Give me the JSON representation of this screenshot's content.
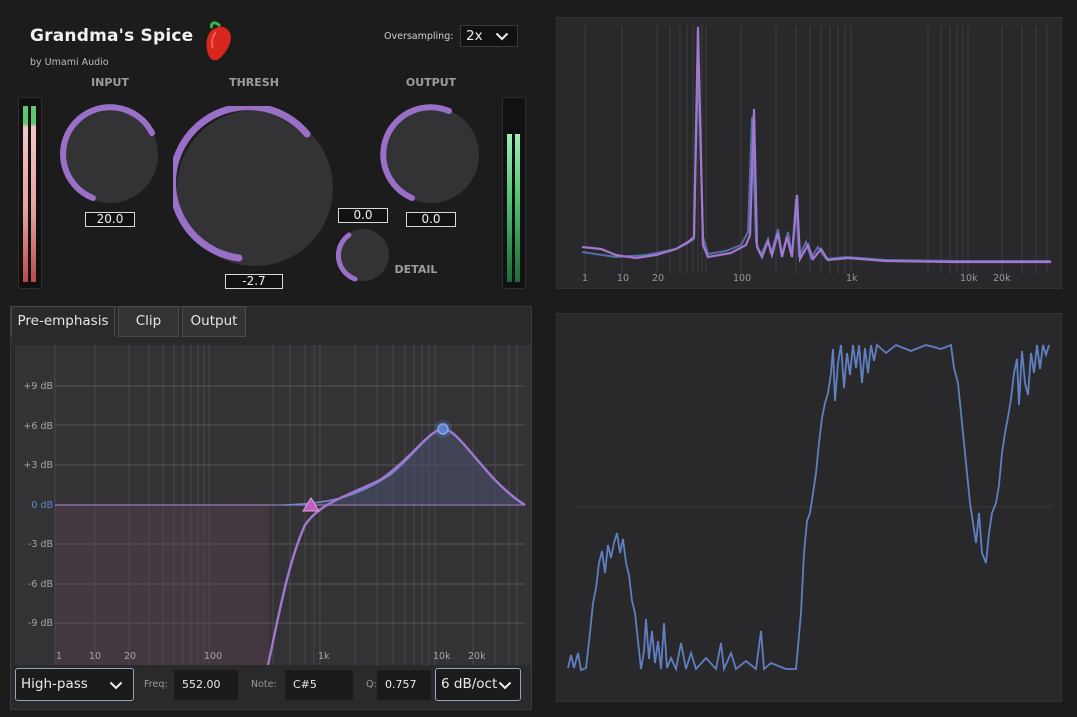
{
  "plugin": {
    "title": "Grandma's Spice",
    "subtitle": "by Umami Audio",
    "logo_icon": "chili-pepper-icon"
  },
  "oversampling": {
    "label": "Oversampling:",
    "value": "2x"
  },
  "knobs": {
    "input": {
      "label": "INPUT",
      "value": "20.0"
    },
    "thresh": {
      "label": "THRESH",
      "value": "-2.7"
    },
    "output": {
      "label": "OUTPUT",
      "value": "0.0"
    },
    "detail": {
      "label": "DETAIL",
      "value": "0.0"
    }
  },
  "tabs": [
    {
      "label": "Pre-emphasis",
      "active": true
    },
    {
      "label": "Clip",
      "active": false
    },
    {
      "label": "Output",
      "active": false
    }
  ],
  "eq_graph": {
    "db_labels": [
      "+9 dB",
      "+6 dB",
      "+3 dB",
      "0 dB",
      "-3 dB",
      "-6 dB",
      "-9 dB"
    ],
    "freq_labels": [
      "1",
      "10",
      "20",
      "100",
      "1k",
      "10k",
      "20k"
    ]
  },
  "filter_controls": {
    "type": "High-pass",
    "freq_label": "Freq:",
    "freq_value": "552.00",
    "note_label": "Note:",
    "note_value": "C#5",
    "q_label": "Q:",
    "q_value": "0.757",
    "slope": "6 dB/oct"
  },
  "spectrum": {
    "freq_labels": [
      "1",
      "10",
      "20",
      "100",
      "1k",
      "10k",
      "20k"
    ]
  },
  "colors": {
    "accent_purple": "#9a6fc7",
    "curve_purple": "#a277d2",
    "wave_blue": "#5f7fc0",
    "meter_green": "#4fc07a",
    "meter_red": "#c85c5c",
    "zero_line_blue": "#5a8ac8"
  }
}
